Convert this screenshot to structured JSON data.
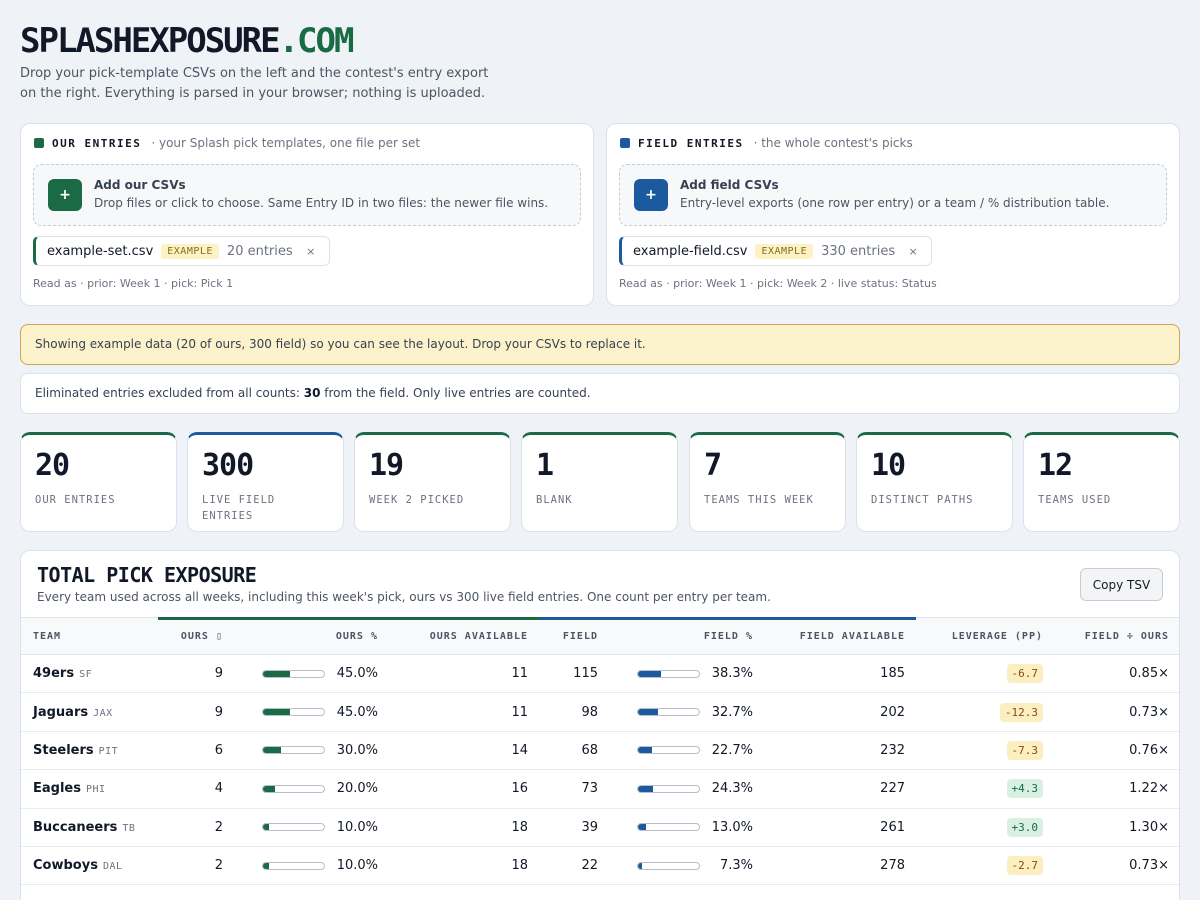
{
  "header": {
    "brand": "SPLASHEXPOSURE",
    "brand_tld": ".COM",
    "tagline": "Drop your pick-template CSVs on the left and the contest's entry export on the right. Everything is parsed in your browser; nothing is uploaded."
  },
  "colors": {
    "ours": "#1a6b45",
    "field": "#1c5aa0"
  },
  "our_entries": {
    "title": "OUR ENTRIES",
    "subtitle": "· your Splash pick templates, one file per set",
    "drop_title": "Add our CSVs",
    "drop_sub": "Drop files or click to choose. Same Entry ID in two files: the newer file wins.",
    "add_icon": "+",
    "file": {
      "name": "example-set.csv",
      "badge": "EXAMPLE",
      "count": "20 entries",
      "remove": "×"
    },
    "read_as": "Read as · prior: Week 1 · pick: Pick 1"
  },
  "field_entries": {
    "title": "FIELD ENTRIES",
    "subtitle": "· the whole contest's picks",
    "drop_title": "Add field CSVs",
    "drop_sub": "Entry-level exports (one row per entry) or a team / % distribution table.",
    "add_icon": "+",
    "file": {
      "name": "example-field.csv",
      "badge": "EXAMPLE",
      "count": "330 entries",
      "remove": "×"
    },
    "read_as": "Read as · prior: Week 1 · pick: Week 2 · live status: Status"
  },
  "banner": "Showing example data (20 of ours, 300 field) so you can see the layout. Drop your CSVs to replace it.",
  "notice": {
    "prefix": "Eliminated entries excluded from all counts: ",
    "count": "30",
    "suffix": " from the field. Only live entries are counted."
  },
  "stats": [
    {
      "value": "20",
      "label": "OUR ENTRIES"
    },
    {
      "value": "300",
      "label": "LIVE FIELD ENTRIES"
    },
    {
      "value": "19",
      "label": "WEEK 2 PICKED"
    },
    {
      "value": "1",
      "label": "BLANK"
    },
    {
      "value": "7",
      "label": "TEAMS THIS WEEK"
    },
    {
      "value": "10",
      "label": "DISTINCT PATHS"
    },
    {
      "value": "12",
      "label": "TEAMS USED"
    }
  ],
  "exposure": {
    "title": "TOTAL PICK EXPOSURE",
    "subtitle": "Every team used across all weeks, including this week's pick, ours vs 300 live field entries. One count per entry per team.",
    "copy_label": "Copy TSV",
    "columns": {
      "team": "TEAM",
      "ours": "OURS",
      "ours_sort": "▯",
      "ours_pct": "OURS %",
      "ours_available": "OURS AVAILABLE",
      "field": "FIELD",
      "field_pct": "FIELD %",
      "field_available": "FIELD AVAILABLE",
      "leverage": "LEVERAGE (PP)",
      "ratio": "FIELD ÷ OURS"
    },
    "rows": [
      {
        "team": "49ers",
        "abbr": "SF",
        "ours": "9",
        "ours_pct": "45.0%",
        "ours_available": "11",
        "field": "115",
        "field_pct": "38.3%",
        "field_available": "185",
        "leverage": "-6.7",
        "ratio": "0.85×"
      },
      {
        "team": "Jaguars",
        "abbr": "JAX",
        "ours": "9",
        "ours_pct": "45.0%",
        "ours_available": "11",
        "field": "98",
        "field_pct": "32.7%",
        "field_available": "202",
        "leverage": "-12.3",
        "ratio": "0.73×"
      },
      {
        "team": "Steelers",
        "abbr": "PIT",
        "ours": "6",
        "ours_pct": "30.0%",
        "ours_available": "14",
        "field": "68",
        "field_pct": "22.7%",
        "field_available": "232",
        "leverage": "-7.3",
        "ratio": "0.76×"
      },
      {
        "team": "Eagles",
        "abbr": "PHI",
        "ours": "4",
        "ours_pct": "20.0%",
        "ours_available": "16",
        "field": "73",
        "field_pct": "24.3%",
        "field_available": "227",
        "leverage": "+4.3",
        "ratio": "1.22×"
      },
      {
        "team": "Buccaneers",
        "abbr": "TB",
        "ours": "2",
        "ours_pct": "10.0%",
        "ours_available": "18",
        "field": "39",
        "field_pct": "13.0%",
        "field_available": "261",
        "leverage": "+3.0",
        "ratio": "1.30×"
      },
      {
        "team": "Cowboys",
        "abbr": "DAL",
        "ours": "2",
        "ours_pct": "10.0%",
        "ours_available": "18",
        "field": "22",
        "field_pct": "7.3%",
        "field_available": "278",
        "leverage": "-2.7",
        "ratio": "0.73×"
      }
    ]
  }
}
